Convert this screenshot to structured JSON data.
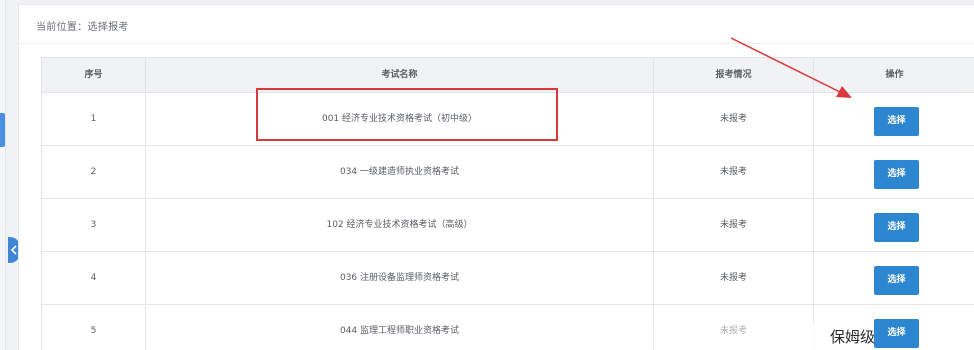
{
  "breadcrumb": "当前位置：选择报考",
  "table": {
    "headers": [
      "序号",
      "考试名称",
      "报考情况",
      "操作"
    ],
    "rows": [
      {
        "index": "1",
        "name": "001 经济专业技术资格考试（初中级）",
        "status": "未报考",
        "action": "选择"
      },
      {
        "index": "2",
        "name": "034 一级建造师执业资格考试",
        "status": "未报考",
        "action": "选择"
      },
      {
        "index": "3",
        "name": "102 经济专业技术资格考试（高级）",
        "status": "未报考",
        "action": "选择"
      },
      {
        "index": "4",
        "name": "036 注册设备监理师资格考试",
        "status": "未报考",
        "action": "选择"
      },
      {
        "index": "5",
        "name": "044 监理工程师职业资格考试",
        "status": "未报考",
        "action": "选择"
      }
    ]
  },
  "watermark": "保姆级",
  "colors": {
    "accent": "#2d86d0",
    "annotation": "#d9393c",
    "header_bg": "#f1f2f4"
  },
  "icons": {
    "collapse": "chevron-left-icon"
  }
}
